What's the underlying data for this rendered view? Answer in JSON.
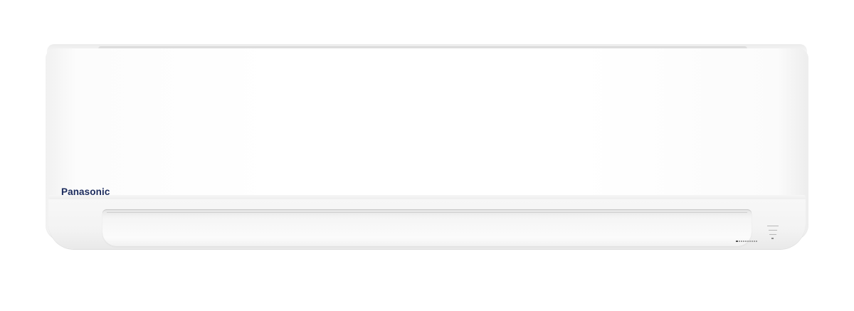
{
  "product": {
    "brand_logo": "Panasonic",
    "type": "wall-mounted air conditioner indoor unit",
    "body_color": "#ffffff",
    "logo_color": "#1a2a5c"
  }
}
